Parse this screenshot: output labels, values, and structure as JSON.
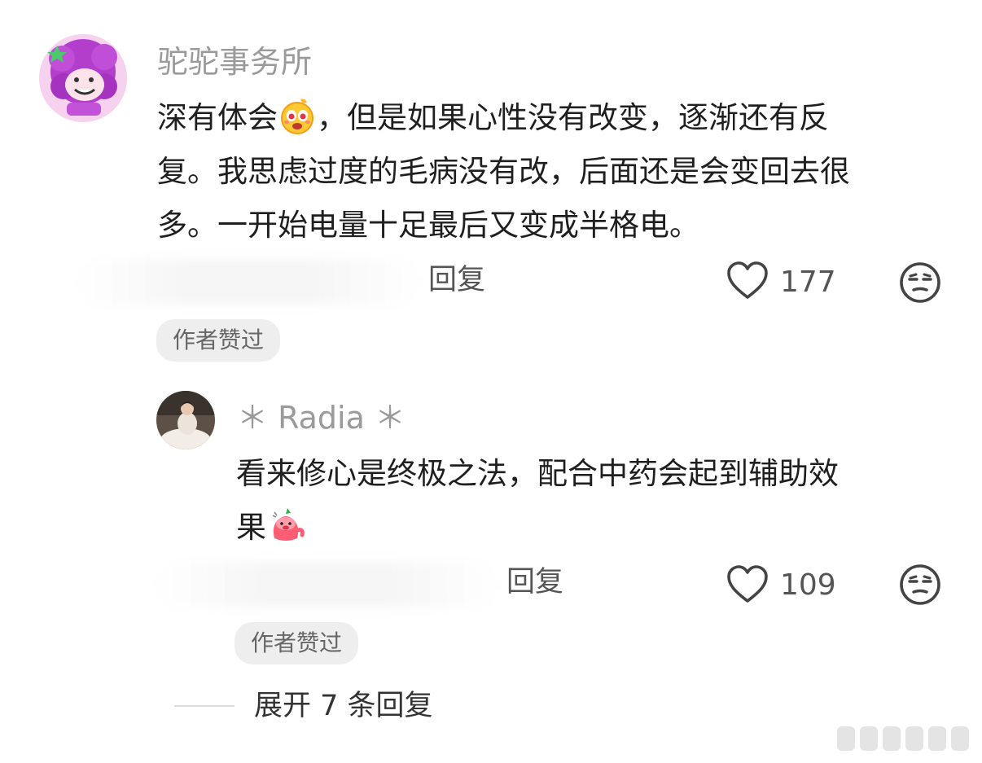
{
  "comment": {
    "username": "驼驼事务所",
    "text_lines": [
      "深有体会",
      "，但是如果心性没有改变，逐渐还有反",
      "复。我思虑过度的毛病没有改，后面还是会变回去很",
      "多。一开始电量十足最后又变成半格电。"
    ],
    "reply_label": "回复",
    "like_count": "177",
    "badge": "作者赞过"
  },
  "reply": {
    "username": "＊ Radia ＊",
    "text_lines": [
      "看来修心是终极之法，配合中药会起到辅助效",
      "果"
    ],
    "reply_label": "回复",
    "like_count": "109",
    "badge": "作者赞过"
  },
  "expand": {
    "label": "展开 7 条回复"
  },
  "icons": {
    "like": "heart-outline-icon",
    "dislike": "unamused-face-icon",
    "emoji1": "surprised-emoji",
    "emoji2": "pink-blob-emoji"
  },
  "colors": {
    "background": "#ffffff",
    "username": "#9a9a9a",
    "text": "#1f1f1f",
    "secondary": "#555555",
    "badge_bg": "#eeeeee",
    "avatar_purple": "#b13bc9"
  }
}
